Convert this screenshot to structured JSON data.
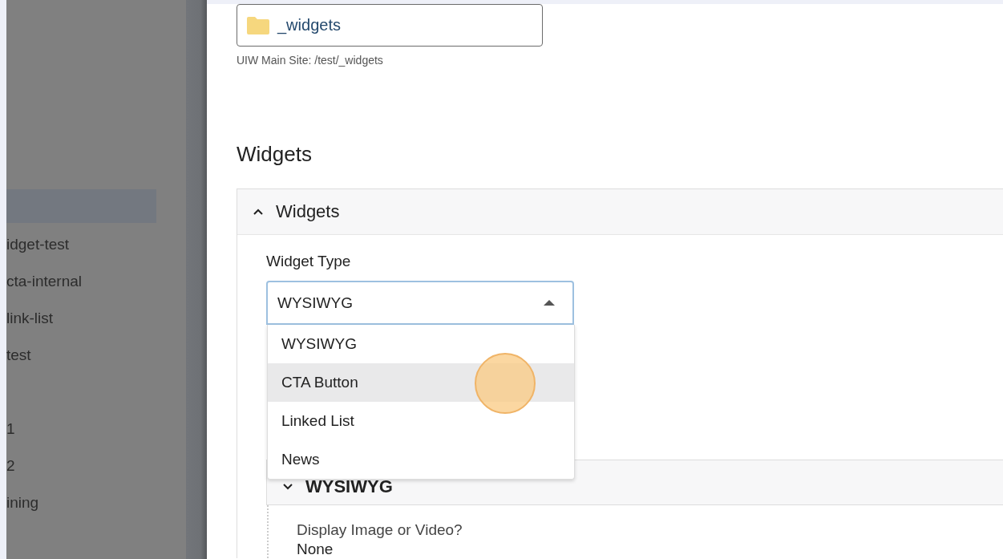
{
  "sidebar": {
    "items": [
      {
        "selected": true
      },
      {
        "label": "idget-test",
        "selected": false
      },
      {
        "label": "cta-internal",
        "selected": false
      },
      {
        "label": "link-list",
        "selected": false
      },
      {
        "label": "test",
        "selected": false
      },
      {
        "label": "1",
        "selected": false
      },
      {
        "label": "2",
        "selected": false
      },
      {
        "label": "ining",
        "selected": false
      }
    ]
  },
  "folder_field": {
    "value": "_widgets",
    "caption": "UIW Main Site: /test/_widgets"
  },
  "section_title": "Widgets",
  "accordion": {
    "title": "Widgets",
    "expanded": true,
    "widget_type": {
      "label": "Widget Type",
      "value": "WYSIWYG",
      "open": true,
      "options": [
        {
          "label": "WYSIWYG",
          "hovered": false
        },
        {
          "label": "CTA Button",
          "hovered": true
        },
        {
          "label": "Linked List",
          "hovered": false
        },
        {
          "label": "News",
          "hovered": false
        }
      ]
    },
    "sub_panel": {
      "title": "WYSIWYG",
      "expanded": false,
      "field_label": "Display Image or Video?",
      "field_value": "None"
    }
  }
}
